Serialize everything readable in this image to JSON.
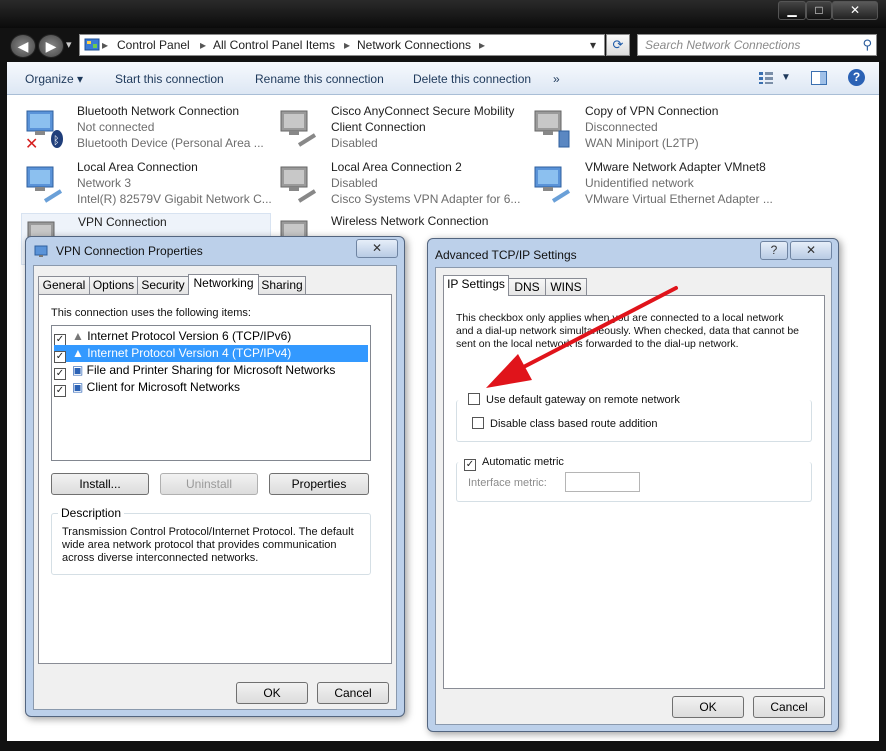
{
  "window": {
    "minimize": "▁",
    "maximize": "□",
    "close": "✕"
  },
  "nav": {
    "back": "◀",
    "forward": "▶",
    "dropdown": "▾",
    "breadcrumbs": [
      "Control Panel",
      "All Control Panel Items",
      "Network Connections"
    ],
    "refresh": "⟳",
    "search_placeholder": "Search Network Connections",
    "search_icon": "⚲"
  },
  "toolbar": {
    "organize": "Organize ▾",
    "start": "Start this connection",
    "rename": "Rename this connection",
    "delete": "Delete this connection",
    "more": "»",
    "help": "?"
  },
  "connections": [
    {
      "name": "Bluetooth Network Connection",
      "line1": "Not connected",
      "line2": "Bluetooth Device (Personal Area ..."
    },
    {
      "name": "Cisco AnyConnect Secure Mobility",
      "line1": "Client Connection",
      "line2": "Disabled"
    },
    {
      "name": "Copy of VPN Connection",
      "line1": "Disconnected",
      "line2": "WAN Miniport (L2TP)"
    },
    {
      "name": "Local Area Connection",
      "line1": "Network  3",
      "line2": "Intel(R) 82579V Gigabit Network C..."
    },
    {
      "name": "Local Area Connection 2",
      "line1": "Disabled",
      "line2": "Cisco Systems VPN Adapter for 6..."
    },
    {
      "name": "VMware Network Adapter VMnet8",
      "line1": "Unidentified network",
      "line2": "VMware Virtual Ethernet Adapter ..."
    },
    {
      "name": "VPN Connection",
      "line1": "",
      "line2": ""
    },
    {
      "name": "Wireless Network Connection",
      "line1": "",
      "line2": ""
    }
  ],
  "vpn_dialog": {
    "title": "VPN Connection Properties",
    "close": "✕",
    "tabs": [
      "General",
      "Options",
      "Security",
      "Networking",
      "Sharing"
    ],
    "items_label": "This connection uses the following items:",
    "items": [
      {
        "label": "Internet Protocol Version 6 (TCP/IPv6)",
        "check": "✓"
      },
      {
        "label": "Internet Protocol Version 4 (TCP/IPv4)",
        "check": "✓"
      },
      {
        "label": "File and Printer Sharing for Microsoft Networks",
        "check": "✓"
      },
      {
        "label": "Client for Microsoft Networks",
        "check": "✓"
      }
    ],
    "install": "Install...",
    "uninstall": "Uninstall",
    "properties": "Properties",
    "desc_label": "Description",
    "desc_text": "Transmission Control Protocol/Internet Protocol. The default wide area network protocol that provides communication across diverse interconnected networks.",
    "ok": "OK",
    "cancel": "Cancel"
  },
  "adv_dialog": {
    "title": "Advanced TCP/IP Settings",
    "help": "?",
    "close": "✕",
    "tabs": [
      "IP Settings",
      "DNS",
      "WINS"
    ],
    "info": "This checkbox only applies when you are connected to a local network and a dial-up network simultaneously.  When checked, data that cannot be sent on the local network is forwarded to the dial-up network.",
    "default_gateway": "Use default gateway on remote network",
    "class_route": "Disable class based route addition",
    "auto_metric": "Automatic metric",
    "auto_metric_check": "✓",
    "interface_metric": "Interface metric:",
    "ok": "OK",
    "cancel": "Cancel"
  },
  "colors": {
    "annotation_arrow": "#e0141b",
    "selection": "#3399ff"
  }
}
